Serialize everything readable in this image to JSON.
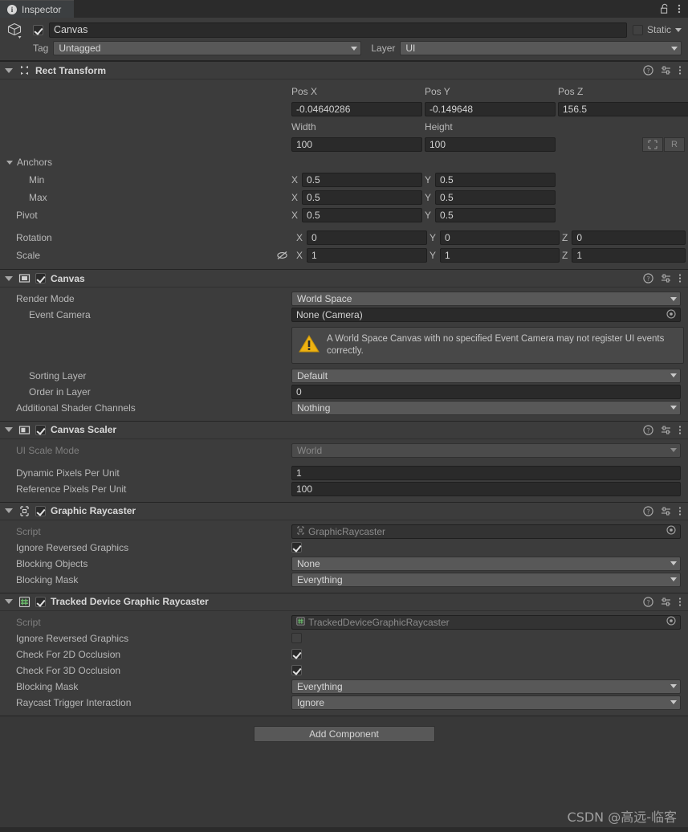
{
  "window": {
    "tab_label": "Inspector",
    "tab_icon": "info-icon",
    "lock_icon": "lock-open-icon",
    "menu_icon": "kebab-menu-icon"
  },
  "object_header": {
    "icon": "cube-icon",
    "enabled": true,
    "name": "Canvas",
    "static_label": "Static",
    "static_checked": false,
    "tag_label": "Tag",
    "tag_value": "Untagged",
    "layer_label": "Layer",
    "layer_value": "UI"
  },
  "components": [
    {
      "id": "rect-transform",
      "title": "Rect Transform",
      "icon": "rect-transform-icon",
      "has_checkbox": false,
      "columns": [
        "Pos X",
        "Pos Y",
        "Pos Z"
      ],
      "pos": {
        "x": "-0.04640286",
        "y": "-0.149648",
        "z": "156.5"
      },
      "size_columns": [
        "Width",
        "Height"
      ],
      "size": {
        "width": "100",
        "height": "100"
      },
      "blueprint_button": "blueprint-mode-icon",
      "raw_button": "R",
      "anchors_label": "Anchors",
      "anchor_rows": [
        {
          "label": "Min",
          "x": "0.5",
          "y": "0.5"
        },
        {
          "label": "Max",
          "x": "0.5",
          "y": "0.5"
        },
        {
          "label": "Pivot",
          "x": "0.5",
          "y": "0.5"
        }
      ],
      "rotation": {
        "label": "Rotation",
        "x": "0",
        "y": "0",
        "z": "0"
      },
      "scale": {
        "label": "Scale",
        "x": "1",
        "y": "1",
        "z": "1",
        "icon": "constrain-proportions-off-icon"
      },
      "axis_labels": {
        "x": "X",
        "y": "Y",
        "z": "Z"
      }
    },
    {
      "id": "canvas",
      "title": "Canvas",
      "icon": "canvas-icon",
      "enabled": true,
      "rows": [
        {
          "label": "Render Mode",
          "type": "dropdown",
          "value": "World Space"
        },
        {
          "label": "Event Camera",
          "type": "object",
          "value": "None (Camera)",
          "indent": 2
        },
        {
          "label": "Sorting Layer",
          "type": "dropdown",
          "value": "Default",
          "indent": 2
        },
        {
          "label": "Order in Layer",
          "type": "text",
          "value": "0",
          "indent": 2
        },
        {
          "label": "Additional Shader Channels",
          "type": "dropdown",
          "value": "Nothing"
        }
      ],
      "warning": {
        "icon": "warning-icon",
        "text": "A World Space Canvas with no specified Event Camera may not register UI events correctly."
      }
    },
    {
      "id": "canvas-scaler",
      "title": "Canvas Scaler",
      "icon": "canvas-scaler-icon",
      "enabled": true,
      "rows": [
        {
          "label": "UI Scale Mode",
          "type": "dropdown",
          "value": "World",
          "disabled": true
        },
        {
          "label": "Dynamic Pixels Per Unit",
          "type": "text",
          "value": "1"
        },
        {
          "label": "Reference Pixels Per Unit",
          "type": "text",
          "value": "100"
        }
      ]
    },
    {
      "id": "graphic-raycaster",
      "title": "Graphic Raycaster",
      "icon": "graphic-raycaster-icon",
      "enabled": true,
      "rows": [
        {
          "label": "Script",
          "type": "object",
          "value": "GraphicRaycaster",
          "disabled": true
        },
        {
          "label": "Ignore Reversed Graphics",
          "type": "checkbox",
          "checked": true
        },
        {
          "label": "Blocking Objects",
          "type": "dropdown",
          "value": "None"
        },
        {
          "label": "Blocking Mask",
          "type": "dropdown",
          "value": "Everything"
        }
      ]
    },
    {
      "id": "tracked-device-graphic-raycaster",
      "title": "Tracked Device Graphic Raycaster",
      "icon": "script-icon",
      "enabled": true,
      "rows": [
        {
          "label": "Script",
          "type": "object",
          "value": "TrackedDeviceGraphicRaycaster",
          "disabled": true
        },
        {
          "label": "Ignore Reversed Graphics",
          "type": "checkbox",
          "checked": false
        },
        {
          "label": "Check For 2D Occlusion",
          "type": "checkbox",
          "checked": true
        },
        {
          "label": "Check For 3D Occlusion",
          "type": "checkbox",
          "checked": true
        },
        {
          "label": "Blocking Mask",
          "type": "dropdown",
          "value": "Everything"
        },
        {
          "label": "Raycast Trigger Interaction",
          "type": "dropdown",
          "value": "Ignore"
        }
      ]
    }
  ],
  "footer": {
    "add_component_label": "Add Component"
  },
  "watermark": "CSDN @高远-临客",
  "colors": {
    "background": "#383838",
    "panel": "#3c3c3c",
    "field": "#2a2a2a",
    "dropdown": "#585858",
    "warning": "#e8a317",
    "text": "#c4c4c4"
  }
}
